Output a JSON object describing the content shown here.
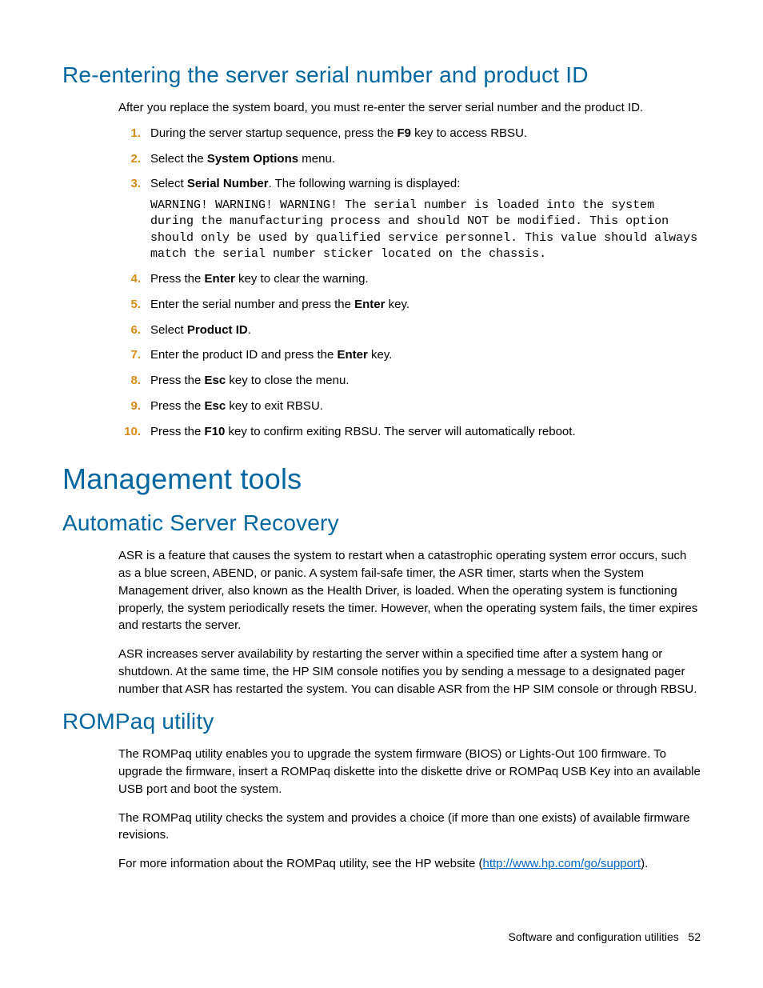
{
  "section1": {
    "heading": "Re-entering the server serial number and product ID",
    "intro": "After you replace the system board, you must re-enter the server serial number and the product ID.",
    "steps": [
      {
        "n": "1.",
        "pre": "During the server startup sequence, press the ",
        "bold": "F9",
        "post": " key to access RBSU."
      },
      {
        "n": "2.",
        "pre": "Select the ",
        "bold": "System Options",
        "post": " menu."
      },
      {
        "n": "3.",
        "pre": "Select ",
        "bold": "Serial Number",
        "post": ". The following warning is displayed:",
        "mono": "WARNING! WARNING! WARNING! The serial number is loaded into the system during the manufacturing process and should NOT be modified. This option should only be used by qualified service personnel. This value should always match the serial number sticker located on the chassis."
      },
      {
        "n": "4.",
        "pre": "Press the ",
        "bold": "Enter",
        "post": " key to clear the warning."
      },
      {
        "n": "5.",
        "pre": "Enter the serial number and press the ",
        "bold": "Enter",
        "post": " key."
      },
      {
        "n": "6.",
        "pre": "Select ",
        "bold": "Product ID",
        "post": "."
      },
      {
        "n": "7.",
        "pre": "Enter the product ID and press the ",
        "bold": "Enter",
        "post": " key."
      },
      {
        "n": "8.",
        "pre": "Press the ",
        "bold": "Esc",
        "post": " key to close the menu."
      },
      {
        "n": "9.",
        "pre": "Press the ",
        "bold": "Esc",
        "post": " key to exit RBSU."
      },
      {
        "n": "10.",
        "pre": "Press the ",
        "bold": "F10",
        "post": " key to confirm exiting RBSU. The server will automatically reboot."
      }
    ]
  },
  "section2": {
    "heading": "Management tools",
    "sub1": {
      "heading": "Automatic Server Recovery",
      "paras": [
        "ASR is a feature that causes the system to restart when a catastrophic operating system error occurs, such as a blue screen, ABEND, or panic. A system fail-safe timer, the ASR timer, starts when the System Management driver, also known as the Health Driver, is loaded. When the operating system is functioning properly, the system periodically resets the timer. However, when the operating system fails, the timer expires and restarts the server.",
        "ASR increases server availability by restarting the server within a specified time after a system hang or shutdown. At the same time, the HP SIM console notifies you by sending a message to a designated pager number that ASR has restarted the system. You can disable ASR from the HP SIM console or through RBSU."
      ]
    },
    "sub2": {
      "heading": "ROMPaq utility",
      "paras": [
        "The ROMPaq utility enables you to upgrade the system firmware (BIOS) or Lights-Out 100 firmware. To upgrade the firmware, insert a ROMPaq diskette into the diskette drive or ROMPaq USB Key into an available USB port and boot the system.",
        "The ROMPaq utility checks the system and provides a choice (if more than one exists) of available firmware revisions."
      ],
      "linkpara": {
        "pre": "For more information about the ROMPaq utility, see the HP website (",
        "link": "http://www.hp.com/go/support",
        "post": ")."
      }
    }
  },
  "footer": {
    "label": "Software and configuration utilities",
    "page": "52"
  }
}
